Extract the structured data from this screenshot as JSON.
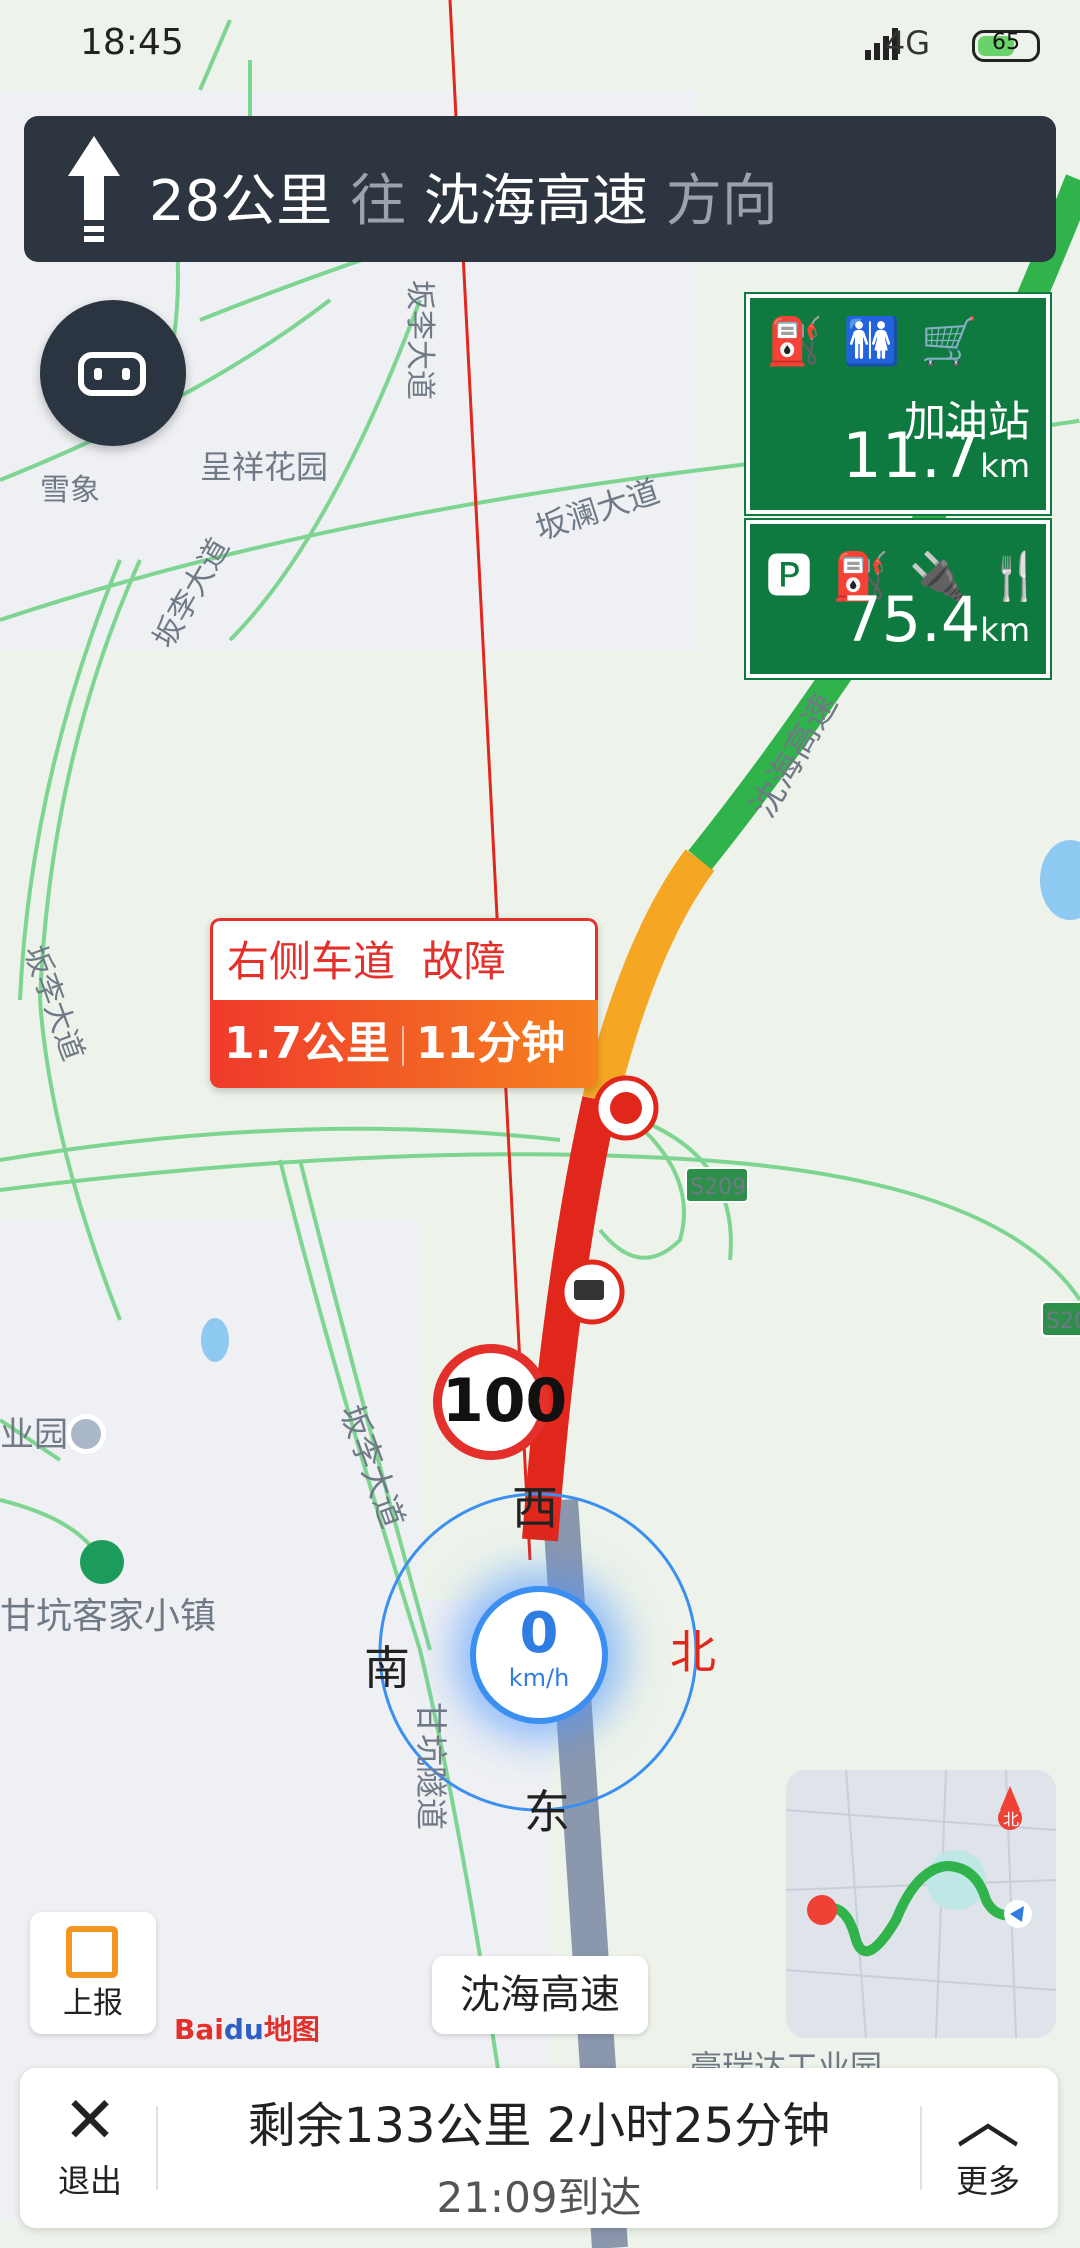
{
  "status_bar": {
    "time": "18:45",
    "network": "4G",
    "battery": "65",
    "battery_level": 0.65
  },
  "guidance": {
    "distance": "28公里",
    "to": "往",
    "road": "沈海高速",
    "direction": "方向"
  },
  "poi_signs": [
    {
      "icons": [
        "fuel-icon",
        "restroom-icon",
        "shop-icon"
      ],
      "name": "加油站",
      "distance": "11.7",
      "unit": "km"
    },
    {
      "icons": [
        "parking-icon",
        "fuel-icon",
        "ev-charging-icon",
        "restaurant-icon"
      ],
      "distance": "75.4",
      "unit": "km"
    }
  ],
  "incident": {
    "lane": "右侧车道",
    "type": "故障",
    "length": "1.7公里",
    "delay": "11分钟"
  },
  "speed_limit": "100",
  "compass": {
    "top": "西",
    "bottom": "东",
    "left": "南",
    "right": "北"
  },
  "speed": {
    "value": "0",
    "unit": "km/h"
  },
  "map_labels": [
    "坂李大道",
    "呈祥花园",
    "雪象",
    "坂澜大道",
    "沈海高速",
    "S209",
    "S20",
    "业园",
    "甘坑客家小镇",
    "甘坑隧道",
    "豪瑞达工业园"
  ],
  "report_button": {
    "label": "上报"
  },
  "brand": {
    "bai": "Bai",
    "du": "du",
    "map": "地图"
  },
  "current_road": "沈海高速",
  "overview_compass": "北",
  "bottom_bar": {
    "exit_label": "退出",
    "remaining": "剩余133公里  2小时25分钟",
    "arrival": "21:09到达",
    "more_label": "更多"
  },
  "colors": {
    "route_congested": "#e1261c",
    "route_slow": "#f5a623",
    "route_clear": "#2fb34a",
    "sign_green": "#0f7a3f",
    "guide_bg": "#2d3541"
  }
}
